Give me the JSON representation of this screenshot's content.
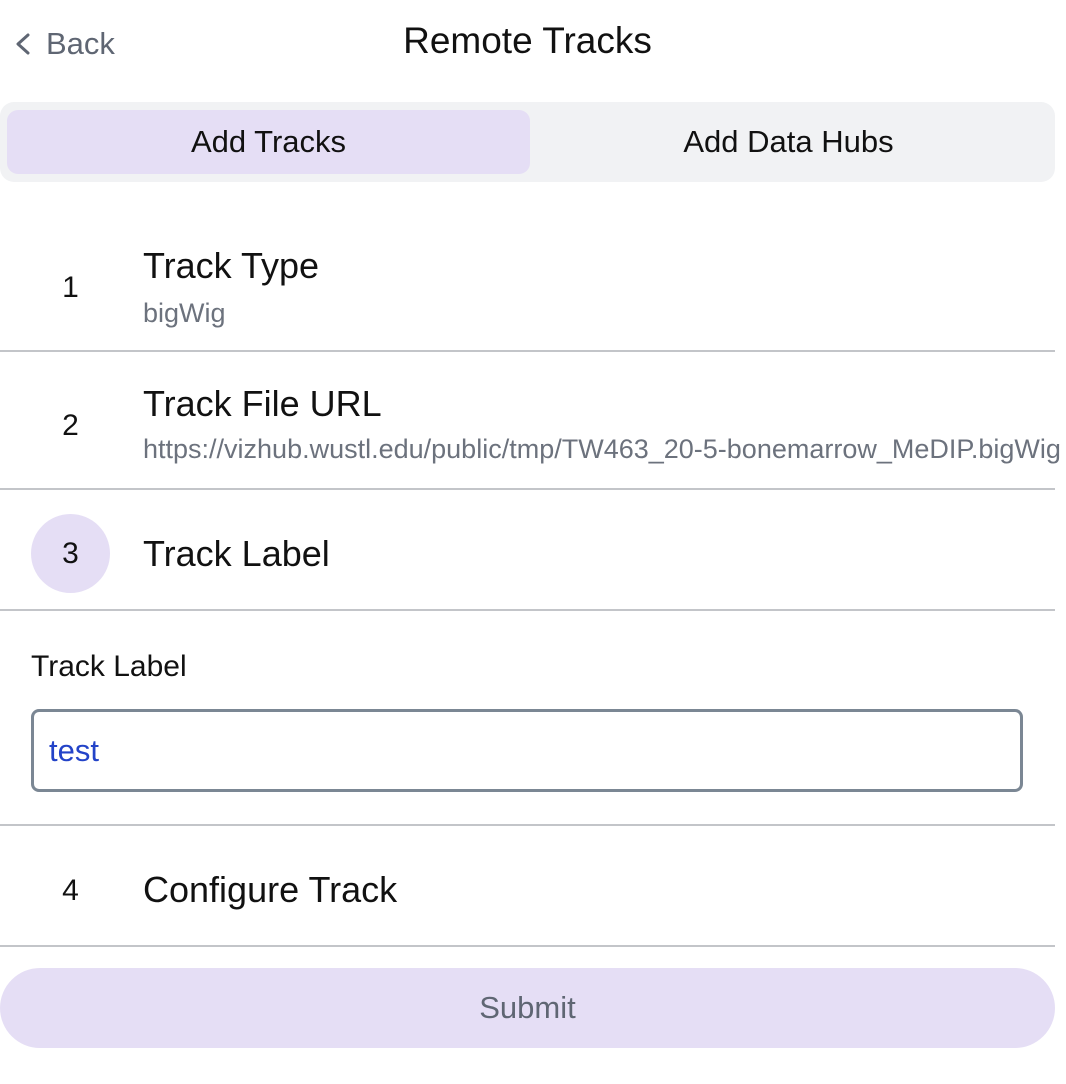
{
  "header": {
    "back_label": "Back",
    "back_icon": "chevron-left-icon",
    "title": "Remote Tracks"
  },
  "tabs": [
    {
      "label": "Add Tracks",
      "active": true
    },
    {
      "label": "Add Data Hubs",
      "active": false
    }
  ],
  "steps": [
    {
      "number": "1",
      "title": "Track Type",
      "value": "bigWig",
      "current": false
    },
    {
      "number": "2",
      "title": "Track File URL",
      "value": "https://vizhub.wustl.edu/public/tmp/TW463_20-5-bonemarrow_MeDIP.bigWig",
      "current": false
    },
    {
      "number": "3",
      "title": "Track Label",
      "value": "",
      "current": true
    },
    {
      "number": "4",
      "title": "Configure Track",
      "value": "",
      "current": false
    }
  ],
  "form": {
    "label": "Track Label",
    "value": "test"
  },
  "submit": {
    "label": "Submit"
  },
  "colors": {
    "accent_light": "#e5def5",
    "input_text": "#2343c8",
    "muted_text": "#6c727d"
  }
}
